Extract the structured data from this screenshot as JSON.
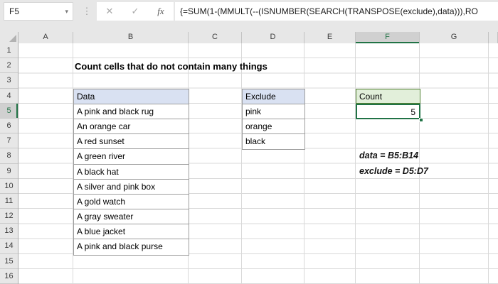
{
  "formula_bar": {
    "cell_reference": "F5",
    "dropdown_icon": "▾",
    "dots_icon": "⋮",
    "cancel_label": "✕",
    "enter_label": "✓",
    "fx_label": "fx",
    "formula": "{=SUM(1-(MMULT(--(ISNUMBER(SEARCH(TRANSPOSE(exclude),data))),RO"
  },
  "grid": {
    "selected_column": "F",
    "selected_row": 5,
    "columns": [
      {
        "letter": "A",
        "width": 77
      },
      {
        "letter": "B",
        "width": 162
      },
      {
        "letter": "C",
        "width": 75
      },
      {
        "letter": "D",
        "width": 88
      },
      {
        "letter": "E",
        "width": 72
      },
      {
        "letter": "F",
        "width": 90
      },
      {
        "letter": "G",
        "width": 97
      },
      {
        "letter": "",
        "width": 13
      }
    ],
    "row_numbers": [
      1,
      2,
      3,
      4,
      5,
      6,
      7,
      8,
      9,
      10,
      11,
      12,
      13,
      14,
      15,
      16
    ]
  },
  "sheet": {
    "title": "Count cells that do not contain many things",
    "data_table": {
      "header": "Data",
      "rows": [
        "A pink and black rug",
        "An orange car",
        "A red sunset",
        "A green river",
        "A black hat",
        "A silver and pink box",
        "A gold watch",
        "A gray sweater",
        "A blue jacket",
        "A pink and black purse"
      ]
    },
    "exclude_table": {
      "header": "Exclude",
      "rows": [
        "pink",
        "orange",
        "black"
      ]
    },
    "count_table": {
      "header": "Count",
      "value": "5"
    },
    "annotations": [
      "data = B5:B14",
      "exclude = D5:D7"
    ]
  },
  "colors": {
    "accent_green": "#217346",
    "header_fill_blue": "#d9e1f2",
    "header_fill_green": "#e2efda",
    "count_border_green": "#548235",
    "table_border_gray": "#9e9e9e"
  }
}
